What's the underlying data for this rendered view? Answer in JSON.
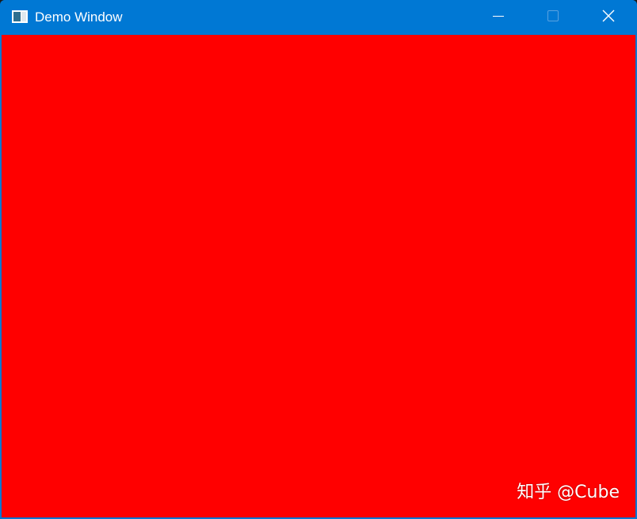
{
  "window": {
    "title": "Demo Window",
    "frame_color": "#0078d4",
    "client_color": "#ff0000"
  },
  "titlebar": {
    "app_icon": "window-app-icon",
    "buttons": [
      {
        "name": "minimize",
        "icon": "minimize-icon"
      },
      {
        "name": "maximize",
        "icon": "maximize-icon",
        "state": "disabled"
      },
      {
        "name": "close",
        "icon": "close-icon"
      }
    ]
  },
  "watermark": {
    "text": "知乎 @Cube"
  }
}
